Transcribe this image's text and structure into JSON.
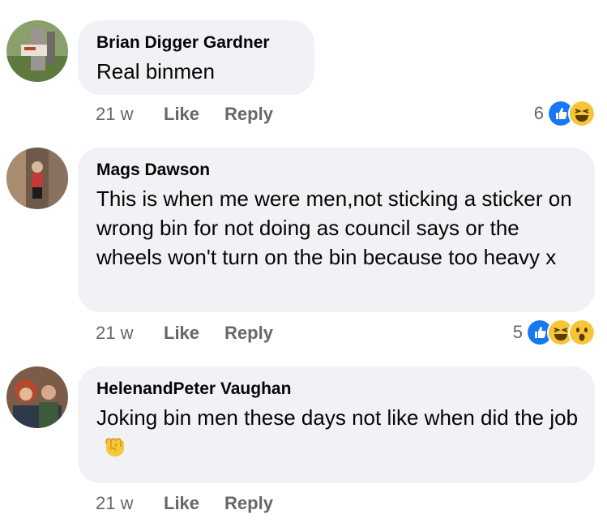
{
  "colors": {
    "bubble": "#f0f2f5",
    "meta_text": "#65676b",
    "like_blue": "#1877f2",
    "emoji_yellow": "#f7c638"
  },
  "comments": [
    {
      "author": "Brian Digger Gardner",
      "text": "Real binmen",
      "time": "21 w",
      "like_label": "Like",
      "reply_label": "Reply",
      "reaction_count": "6",
      "reaction_icons": [
        "like-icon",
        "laugh-icon"
      ]
    },
    {
      "author": "Mags Dawson",
      "text": "This is when me  were men,not sticking a sticker on wrong bin for not doing as council says or the wheels won't turn on the bin because too heavy x",
      "time": "21 w",
      "like_label": "Like",
      "reply_label": "Reply",
      "reaction_count": "5",
      "reaction_icons": [
        "like-icon",
        "laugh-icon",
        "wow-icon"
      ]
    },
    {
      "author": "HelenandPeter Vaughan",
      "text": "Joking bin men these days not like when did the job",
      "trailing_emoji": "raised-fist-icon",
      "time": "21 w",
      "like_label": "Like",
      "reply_label": "Reply"
    }
  ]
}
